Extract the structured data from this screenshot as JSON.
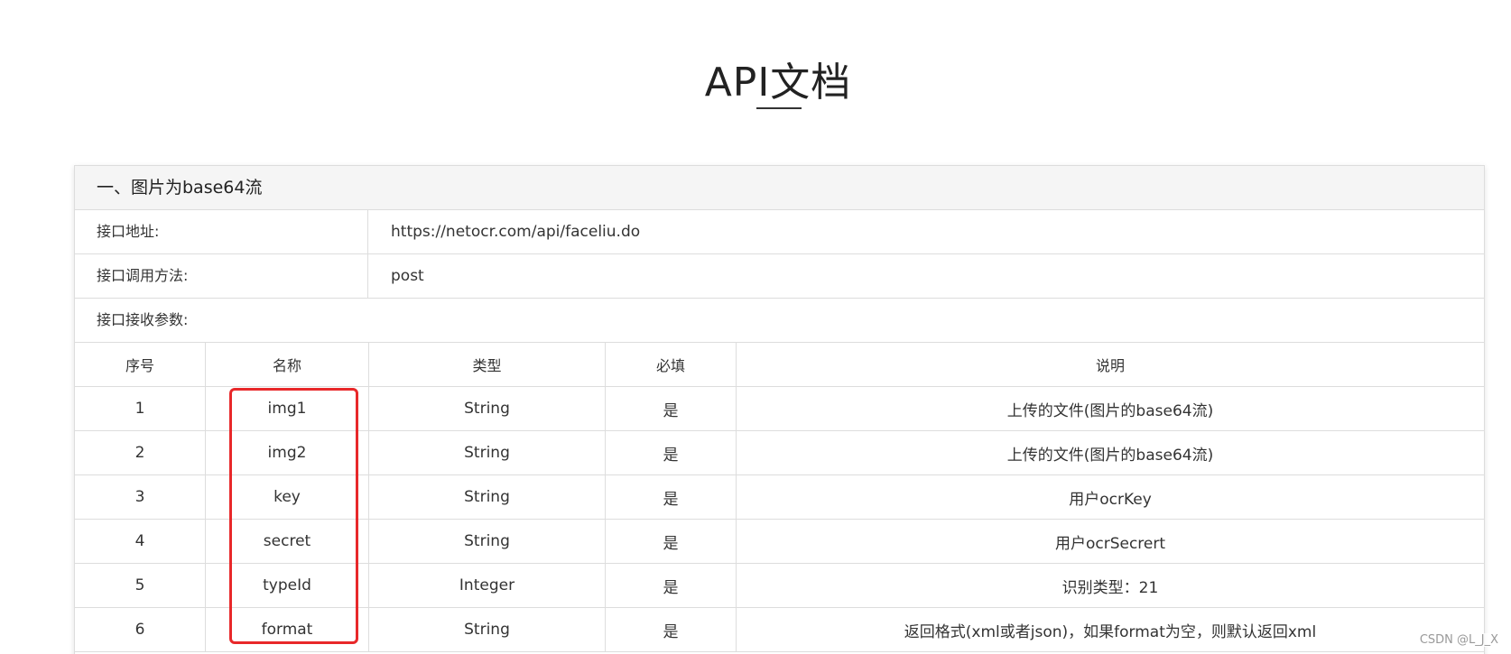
{
  "page": {
    "title": "API文档"
  },
  "section": {
    "header": "一、图片为base64流",
    "endpoint_label": "接口地址:",
    "endpoint_value": "https://netocr.com/api/faceliu.do",
    "method_label": "接口调用方法:",
    "method_value": "post",
    "params_label": "接口接收参数:"
  },
  "table": {
    "headers": [
      "序号",
      "名称",
      "类型",
      "必填",
      "说明"
    ],
    "rows": [
      {
        "index": "1",
        "name": "img1",
        "type": "String",
        "required": "是",
        "desc": "上传的文件(图片的base64流)"
      },
      {
        "index": "2",
        "name": "img2",
        "type": "String",
        "required": "是",
        "desc": "上传的文件(图片的base64流)"
      },
      {
        "index": "3",
        "name": "key",
        "type": "String",
        "required": "是",
        "desc": "用户ocrKey"
      },
      {
        "index": "4",
        "name": "secret",
        "type": "String",
        "required": "是",
        "desc": "用户ocrSecrert"
      },
      {
        "index": "5",
        "name": "typeId",
        "type": "Integer",
        "required": "是",
        "desc": "识别类型：21"
      },
      {
        "index": "6",
        "name": "format",
        "type": "String",
        "required": "是",
        "desc": "返回格式(xml或者json)，如果format为空，则默认返回xml"
      }
    ]
  },
  "annotation": {
    "color": "#e8282a"
  },
  "watermark": "CSDN @L_J_X"
}
